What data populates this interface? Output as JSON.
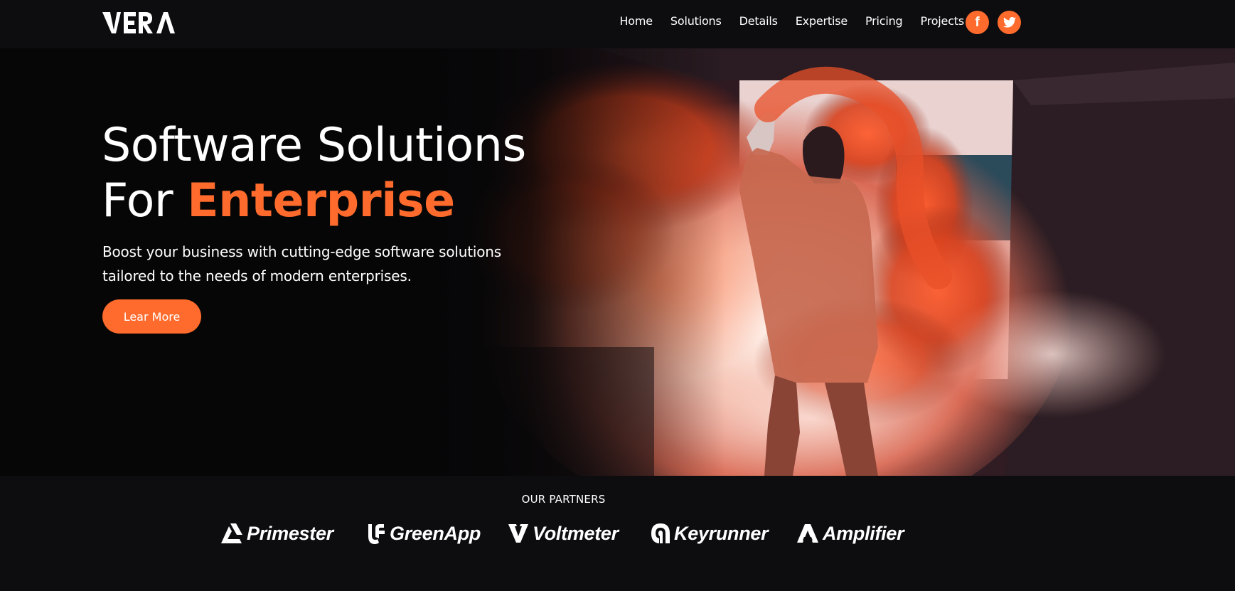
{
  "brand": {
    "logo_text": "VERA",
    "accent_color": "#ff6b2c"
  },
  "nav": {
    "links": [
      "Home",
      "Solutions",
      "Details",
      "Expertise",
      "Pricing",
      "Projects"
    ],
    "social": [
      {
        "icon": "facebook-icon",
        "glyph": "f"
      },
      {
        "icon": "twitter-icon"
      }
    ]
  },
  "hero": {
    "title_line1": "Software Solutions",
    "title_for": "For ",
    "title_accent": "Enterprise",
    "subtitle": "Boost your business with cutting-edge software solutions tailored to the needs of modern enterprises.",
    "cta_label": "Lear More"
  },
  "partners": {
    "title": "OUR PARTNERS",
    "items": [
      {
        "name": "Primester",
        "icon": "primester-logo-icon"
      },
      {
        "name": "GreenApp",
        "icon": "greenapp-logo-icon"
      },
      {
        "name": "Voltmeter",
        "icon": "voltmeter-logo-icon"
      },
      {
        "name": "Keyrunner",
        "icon": "keyrunner-logo-icon"
      },
      {
        "name": "Amplifier",
        "icon": "amplifier-logo-icon"
      }
    ]
  }
}
